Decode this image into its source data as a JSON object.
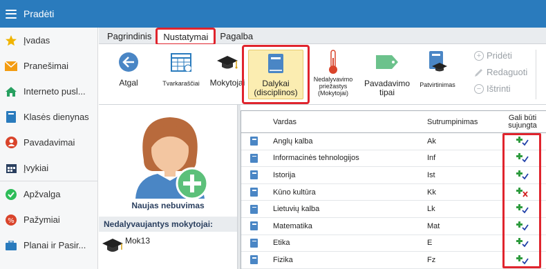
{
  "topbar": {
    "title": "Pradėti"
  },
  "sidebar": {
    "items": [
      {
        "label": "Įvadas",
        "icon": "star-icon",
        "color": "#f0b400"
      },
      {
        "label": "Pranešimai",
        "icon": "envelope-icon",
        "color": "#f39c12"
      },
      {
        "label": "Interneto pusl...",
        "icon": "home-icon",
        "color": "#27a060"
      },
      {
        "label": "Klasės dienynas",
        "icon": "journal-icon",
        "color": "#2a7bbd"
      },
      {
        "label": "Pavadavimai",
        "icon": "user-swap-icon",
        "color": "#d9442b"
      },
      {
        "label": "Įvykiai",
        "icon": "calendar-icon",
        "color": "#2a3f5f"
      },
      {
        "label": "Apžvalga",
        "icon": "check-circle-icon",
        "color": "#2ebd59"
      },
      {
        "label": "Pažymiai",
        "icon": "grade-icon",
        "color": "#d9442b"
      },
      {
        "label": "Planai ir Pasir...",
        "icon": "briefcase-icon",
        "color": "#2a7bbd"
      }
    ]
  },
  "tabs": [
    {
      "label": "Pagrindinis"
    },
    {
      "label": "Nustatymai"
    },
    {
      "label": "Pagalba"
    }
  ],
  "ribbon": {
    "back": "Atgal",
    "timetables": "Tvarkaraščiai",
    "teachers": "Mokytojai",
    "subjects_line1": "Dalykai",
    "subjects_line2": "(disciplinos)",
    "absence_line1": "Nedalyvavimo",
    "absence_line2": "priežastys",
    "absence_line3": "(Mokytojai)",
    "sub_types_line1": "Pavadavimo",
    "sub_types_line2": "tipai",
    "confirmations": "Patvirtinimas",
    "add": "Pridėti",
    "edit": "Redaguoti",
    "delete": "Ištrinti"
  },
  "profile": {
    "name": "Naujas nebuvimas",
    "absent_header": "Nedalyvaujantys mokytojai:",
    "teacher": "Mok13"
  },
  "grid": {
    "headers": {
      "name": "Vardas",
      "abbr": "Sutrumpinimas",
      "join_line1": "Gali būti",
      "join_line2": "sujungta"
    },
    "rows": [
      {
        "name": "Anglų kalba",
        "abbr": "Ak",
        "joinable": true
      },
      {
        "name": "Informacinės tehnologijos",
        "abbr": "Inf",
        "joinable": true
      },
      {
        "name": "Istorija",
        "abbr": "Ist",
        "joinable": true
      },
      {
        "name": "Kūno kultūra",
        "abbr": "Kk",
        "joinable": false
      },
      {
        "name": "Lietuvių kalba",
        "abbr": "Lk",
        "joinable": true
      },
      {
        "name": "Matematika",
        "abbr": "Mat",
        "joinable": true
      },
      {
        "name": "Etika",
        "abbr": "E",
        "joinable": true
      },
      {
        "name": "Fizika",
        "abbr": "Fz",
        "joinable": true
      }
    ]
  },
  "colors": {
    "topbar": "#2a7bbd",
    "highlight_outline": "#e0242d",
    "selected_button": "#fbedb1"
  }
}
